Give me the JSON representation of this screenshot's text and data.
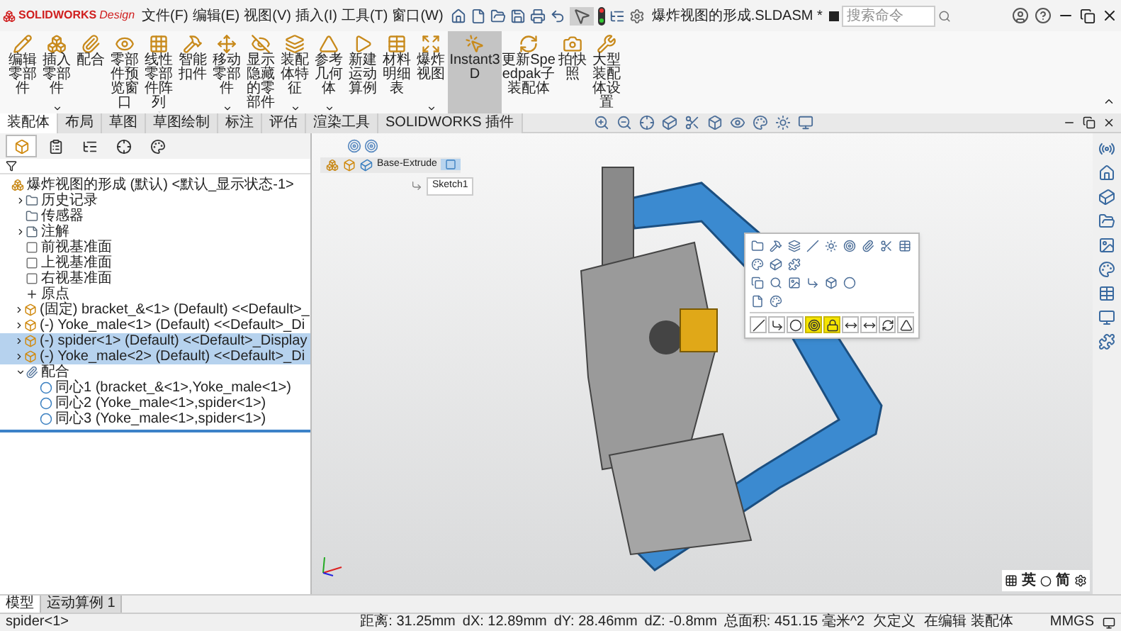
{
  "title_bar": {
    "logo_main": "SOLIDWORKS",
    "logo_sub": "Design",
    "menus": [
      "文件(F)",
      "编辑(E)",
      "视图(V)",
      "插入(I)",
      "工具(T)",
      "窗口(W)"
    ],
    "document_title": "爆炸视图的形成.SLDASM *",
    "search": {
      "placeholder": "搜索命令"
    }
  },
  "ribbon": [
    {
      "label": "编辑零部件",
      "dropdown": false,
      "selected": false
    },
    {
      "label": "插入零部件",
      "dropdown": true,
      "selected": false
    },
    {
      "label": "配合",
      "dropdown": false,
      "selected": false
    },
    {
      "label": "零部件预览窗口",
      "dropdown": false,
      "selected": false
    },
    {
      "label": "线性零部件阵列",
      "dropdown": true,
      "selected": false
    },
    {
      "label": "智能扣件",
      "dropdown": false,
      "selected": false
    },
    {
      "label": "移动零部件",
      "dropdown": true,
      "selected": false
    },
    {
      "label": "显示隐藏的零部件",
      "dropdown": false,
      "selected": false
    },
    {
      "label": "装配体特征",
      "dropdown": true,
      "selected": false
    },
    {
      "label": "参考几何体",
      "dropdown": true,
      "selected": false
    },
    {
      "label": "新建运动算例",
      "dropdown": false,
      "selected": false
    },
    {
      "label": "材料明细表",
      "dropdown": false,
      "selected": false
    },
    {
      "label": "爆炸视图",
      "dropdown": true,
      "selected": false
    },
    {
      "label": "Instant3D",
      "dropdown": false,
      "selected": true
    },
    {
      "label": "更新Speedpak子装配体",
      "dropdown": false,
      "selected": false
    },
    {
      "label": "拍快照",
      "dropdown": false,
      "selected": false
    },
    {
      "label": "大型装配体设置",
      "dropdown": false,
      "selected": false
    }
  ],
  "command_tabs": [
    {
      "label": "装配体",
      "selected": true
    },
    {
      "label": "布局",
      "selected": false
    },
    {
      "label": "草图",
      "selected": false
    },
    {
      "label": "草图绘制",
      "selected": false
    },
    {
      "label": "标注",
      "selected": false
    },
    {
      "label": "评估",
      "selected": false
    },
    {
      "label": "渲染工具",
      "selected": false
    },
    {
      "label": "SOLIDWORKS 插件",
      "selected": false
    }
  ],
  "panel_tabs": [
    {
      "selected": true
    },
    {
      "selected": false
    },
    {
      "selected": false
    },
    {
      "selected": false
    },
    {
      "selected": false
    }
  ],
  "feature_tree": {
    "label": "爆炸视图的形成 (默认) <默认_显示状态-1>",
    "kind": "assembly",
    "children": [
      {
        "label": "历史记录",
        "kind": "folder",
        "expanded": false,
        "selected": false
      },
      {
        "label": "传感器",
        "kind": "folder",
        "selected": false
      },
      {
        "label": "注解",
        "kind": "annotation",
        "expanded": false,
        "selected": false
      },
      {
        "label": "前视基准面",
        "kind": "plane",
        "selected": false
      },
      {
        "label": "上视基准面",
        "kind": "plane",
        "selected": false
      },
      {
        "label": "右视基准面",
        "kind": "plane",
        "selected": false
      },
      {
        "label": "原点",
        "kind": "origin",
        "selected": false
      },
      {
        "label": "(固定) bracket_&<1> (Default) <<Default>_",
        "kind": "component",
        "expanded": false,
        "selected": false
      },
      {
        "label": "(-) Yoke_male<1> (Default) <<Default>_Di",
        "kind": "component",
        "expanded": false,
        "selected": false
      },
      {
        "label": "(-) spider<1> (Default) <<Default>_Display",
        "kind": "component",
        "expanded": false,
        "selected": true
      },
      {
        "label": "(-) Yoke_male<2> (Default) <<Default>_Di",
        "kind": "component",
        "expanded": false,
        "selected": true
      },
      {
        "label": "配合",
        "kind": "mates",
        "expanded": true,
        "selected": false,
        "children": [
          {
            "label": "同心1 (bracket_&<1>,Yoke_male<1>)",
            "kind": "mate",
            "selected": false
          },
          {
            "label": "同心2 (Yoke_male<1>,spider<1>)",
            "kind": "mate",
            "selected": false
          },
          {
            "label": "同心3 (Yoke_male<1>,spider<1>)",
            "kind": "mate",
            "selected": false
          }
        ]
      }
    ]
  },
  "breadcrumb": {
    "feature": "Base-Extrude",
    "sketch": "Sketch1"
  },
  "context_toolbar": {
    "mate_buttons": [
      {
        "selected": false
      },
      {
        "selected": false
      },
      {
        "selected": false
      },
      {
        "selected": true
      },
      {
        "selected": true
      },
      {
        "selected": false
      },
      {
        "selected": false
      },
      {
        "selected": false
      },
      {
        "selected": false
      }
    ]
  },
  "bottom_tabs": [
    {
      "label": "模型",
      "selected": true
    },
    {
      "label": "运动算例 1",
      "selected": false
    }
  ],
  "ime_bar": {
    "language": "英",
    "script": "简"
  },
  "status_bar": {
    "selection": "spider<1>",
    "readings": [
      "距离: 31.25mm",
      "dX: 12.89mm",
      "dY: 28.46mm",
      "dZ: -0.8mm",
      "总面积: 451.15 毫米^2"
    ],
    "definition": "欠定义",
    "mode": "在编辑 装配体",
    "units": "MMGS"
  }
}
